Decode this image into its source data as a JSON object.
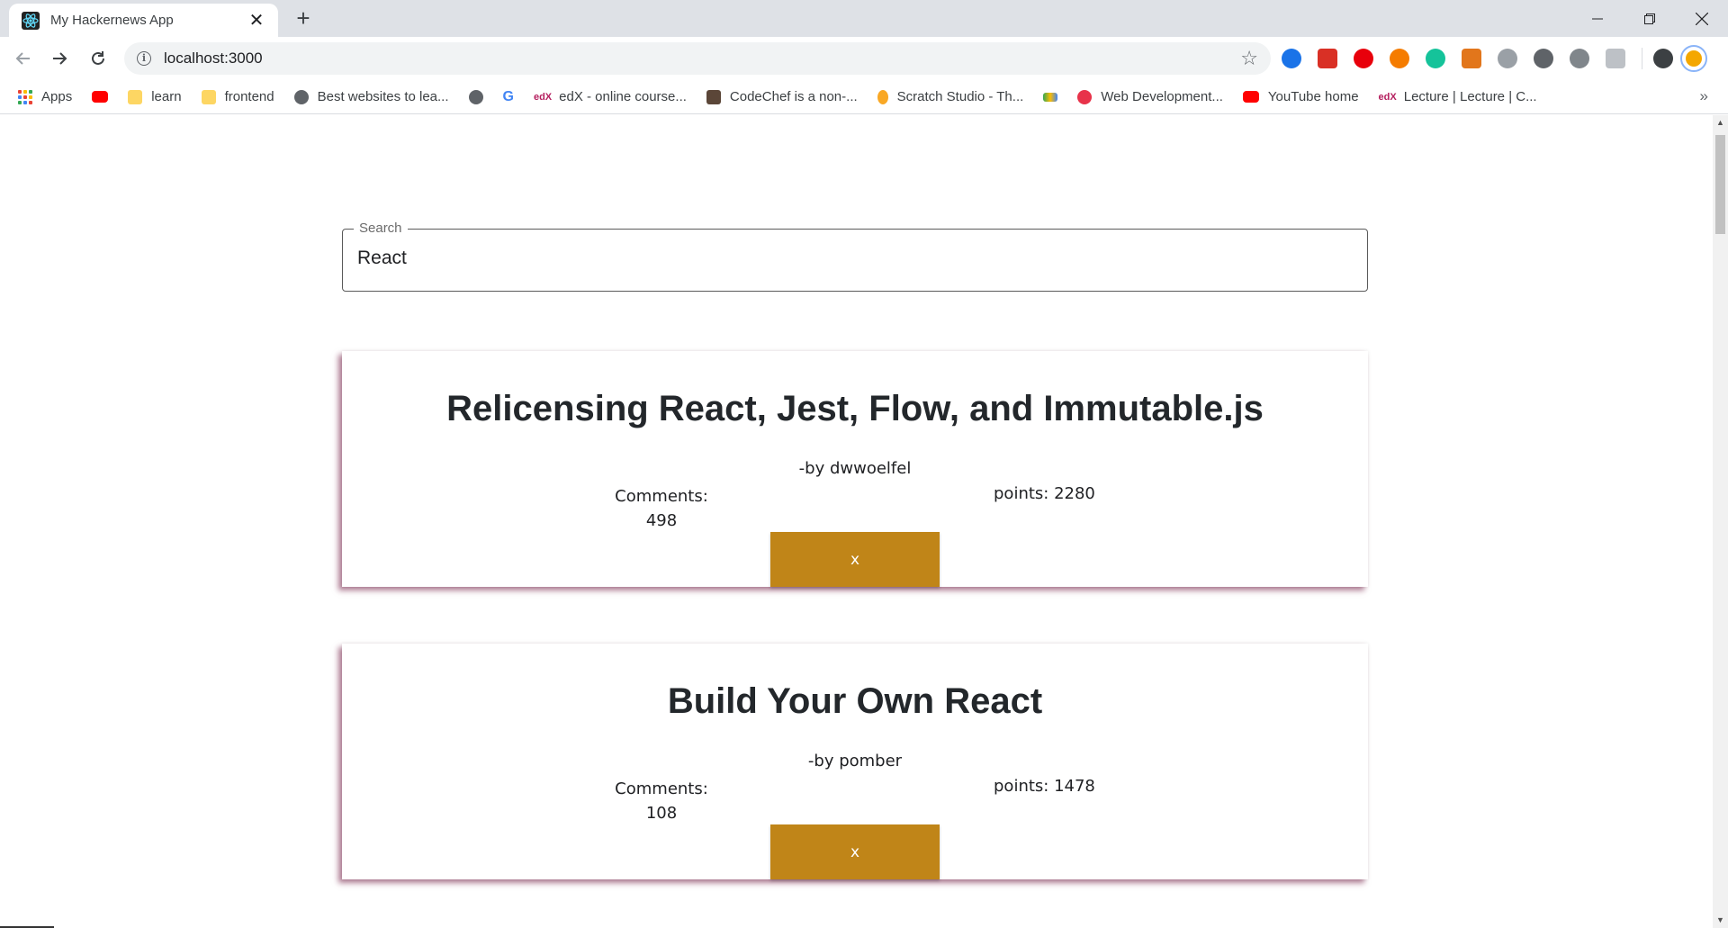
{
  "browser": {
    "tab": {
      "title": "My Hackernews App",
      "favicon": "react-icon"
    },
    "url": "localhost:3000",
    "bookmarks": [
      {
        "label": "Apps",
        "icon": "apps-grid-icon"
      },
      {
        "label": "",
        "icon": "youtube-icon"
      },
      {
        "label": "learn",
        "icon": "folder-icon"
      },
      {
        "label": "frontend",
        "icon": "folder-icon"
      },
      {
        "label": "Best websites to lea...",
        "icon": "globe-icon"
      },
      {
        "label": "",
        "icon": "globe-icon"
      },
      {
        "label": "",
        "icon": "google-icon"
      },
      {
        "label": "edX - online course...",
        "icon": "edx-icon"
      },
      {
        "label": "CodeChef is a non-...",
        "icon": "codechef-icon"
      },
      {
        "label": "Scratch Studio - Th...",
        "icon": "scratch-icon"
      },
      {
        "label": "",
        "icon": "maps-icon"
      },
      {
        "label": "Web Development...",
        "icon": "r-icon"
      },
      {
        "label": "YouTube home",
        "icon": "youtube-icon"
      },
      {
        "label": "Lecture | Lecture | C...",
        "icon": "edx-icon"
      }
    ],
    "more_bookmarks": "»"
  },
  "search": {
    "label": "Search",
    "value": "React"
  },
  "stories": [
    {
      "title": "Relicensing React, Jest, Flow, and Immutable.js",
      "author": "-by dwwoelfel",
      "comments_label": "Comments:",
      "comments": "498",
      "points": "points: 2280",
      "remove_label": "x"
    },
    {
      "title": "Build Your Own React",
      "author": "-by pomber",
      "comments_label": "Comments:",
      "comments": "108",
      "points": "points: 1478",
      "remove_label": "x"
    }
  ],
  "colors": {
    "remove_button": "#c08518",
    "card_shadow": "#6e143c"
  }
}
